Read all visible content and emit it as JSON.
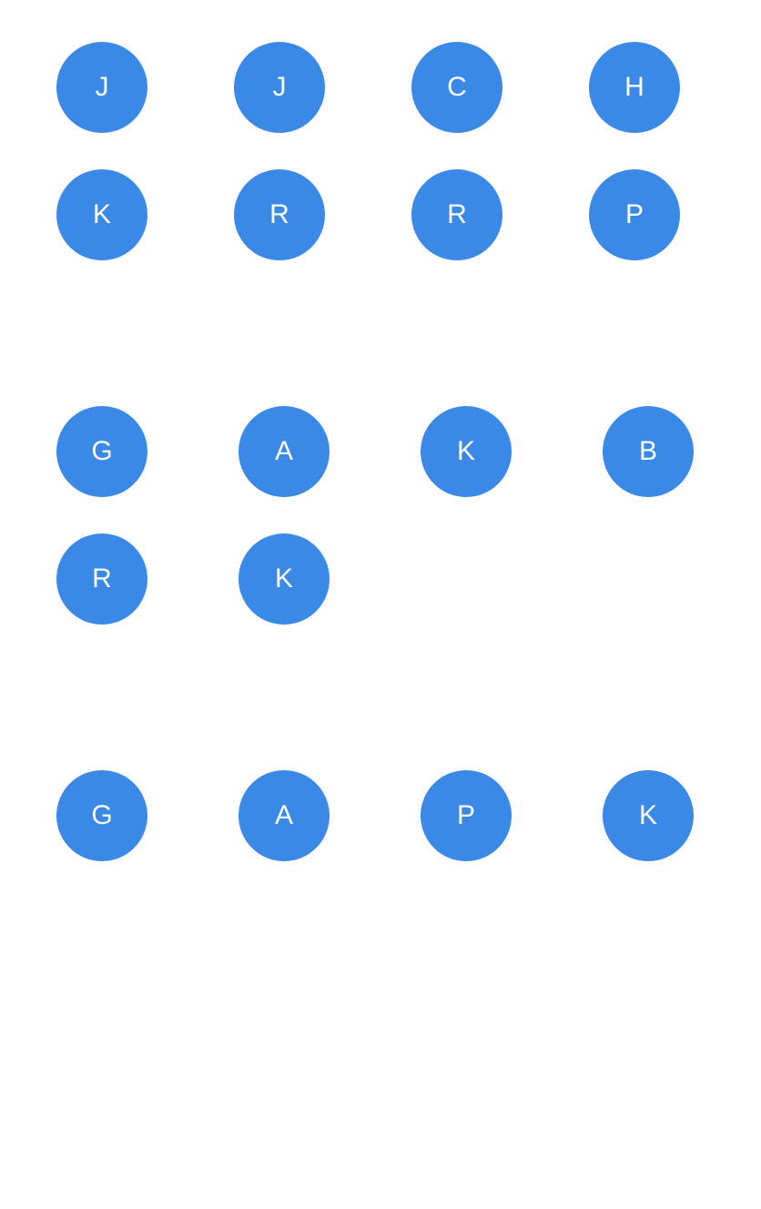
{
  "accent_color": "#3b89e6",
  "groups": [
    {
      "avatars": [
        "J",
        "J",
        "C",
        "H",
        "K",
        "R",
        "R",
        "P"
      ]
    },
    {
      "avatars": [
        "G",
        "A",
        "K",
        "B",
        "R",
        "K"
      ]
    },
    {
      "avatars": [
        "G",
        "A",
        "P",
        "K"
      ]
    }
  ]
}
